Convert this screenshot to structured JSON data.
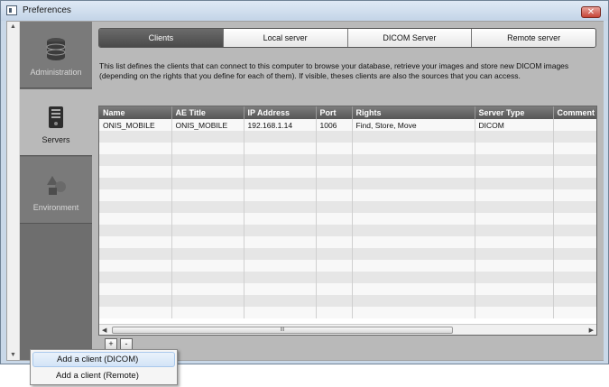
{
  "window": {
    "title": "Preferences"
  },
  "nav": {
    "items": [
      {
        "label": "Administration",
        "icon": "database-icon"
      },
      {
        "label": "Servers",
        "icon": "server-icon"
      },
      {
        "label": "Environment",
        "icon": "shapes-icon"
      }
    ],
    "active": "Servers"
  },
  "tabs": [
    "Clients",
    "Local server",
    "DICOM Server",
    "Remote server"
  ],
  "description": "This list defines the clients that can connect to this computer to browse your database, retrieve your images and store new DICOM images (depending on the rights that you define for each of them).  If visible, theses clients are also the sources that you can access.",
  "table": {
    "columns": [
      "Name",
      "AE Title",
      "IP Address",
      "Port",
      "Rights",
      "Server Type",
      "Comment"
    ],
    "rows": [
      [
        "ONIS_MOBILE",
        "ONIS_MOBILE",
        "192.168.1.14",
        "1006",
        "Find, Store, Move",
        "DICOM",
        ""
      ]
    ]
  },
  "buttons": {
    "add": "+",
    "remove": "-"
  },
  "scroll": {
    "grip": "III"
  },
  "menu": {
    "items": [
      "Add a client (DICOM)",
      "Add a client (Remote)"
    ]
  },
  "colors": {
    "accent_dark": "#4a4a4a",
    "close": "#c64436"
  }
}
